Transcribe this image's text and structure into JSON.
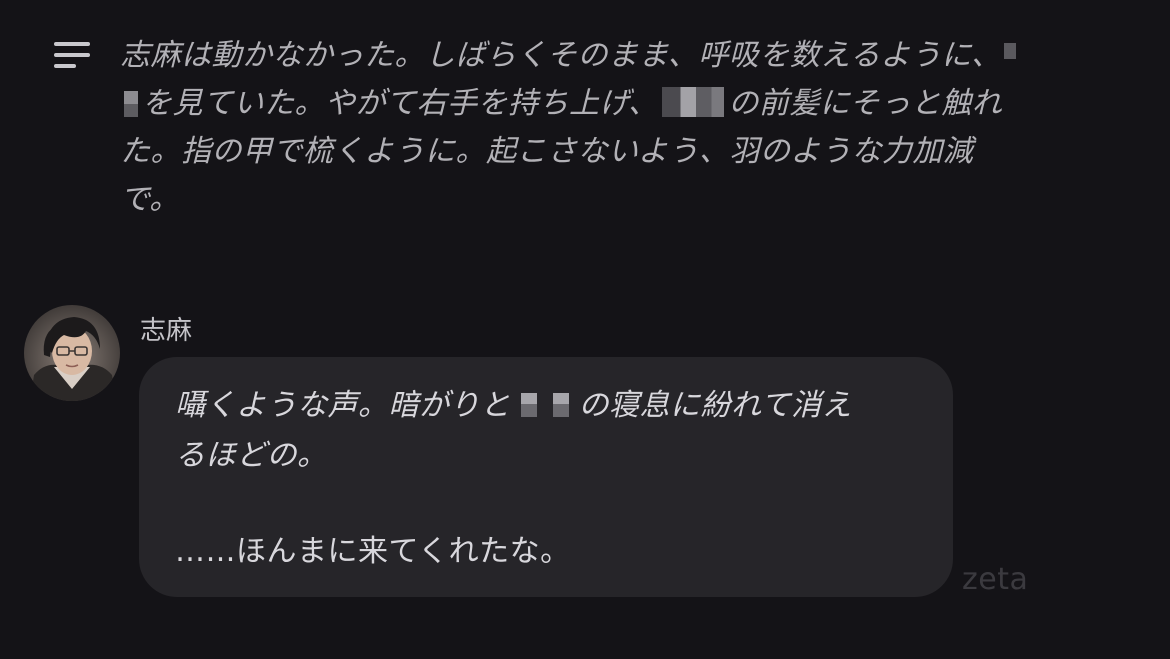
{
  "narration": {
    "line1": "志麻は動かなかった。しばらくそのまま、呼吸を数えるように、",
    "line2a": "を見ていた。やがて右手を持ち上げ、",
    "line2b": "の前髪にそっと触れ",
    "line3": "た。指の甲で梳くように。起こさないよう、羽のような力加減",
    "line4": "で。"
  },
  "message": {
    "sender": "志麻",
    "avatar_icon": "avatar-portrait-icon",
    "text_line1a": "囁くような声。暗がりと",
    "text_line1b": "の寝息に紛れて消え",
    "text_line2": "るほどの。",
    "speech": "……ほんまに来てくれたな。"
  },
  "watermark": "zeta",
  "colors": {
    "background": "#141317",
    "bubble": "#262529",
    "narration_text": "#b2b1b6",
    "message_text": "#d8d7dc"
  }
}
